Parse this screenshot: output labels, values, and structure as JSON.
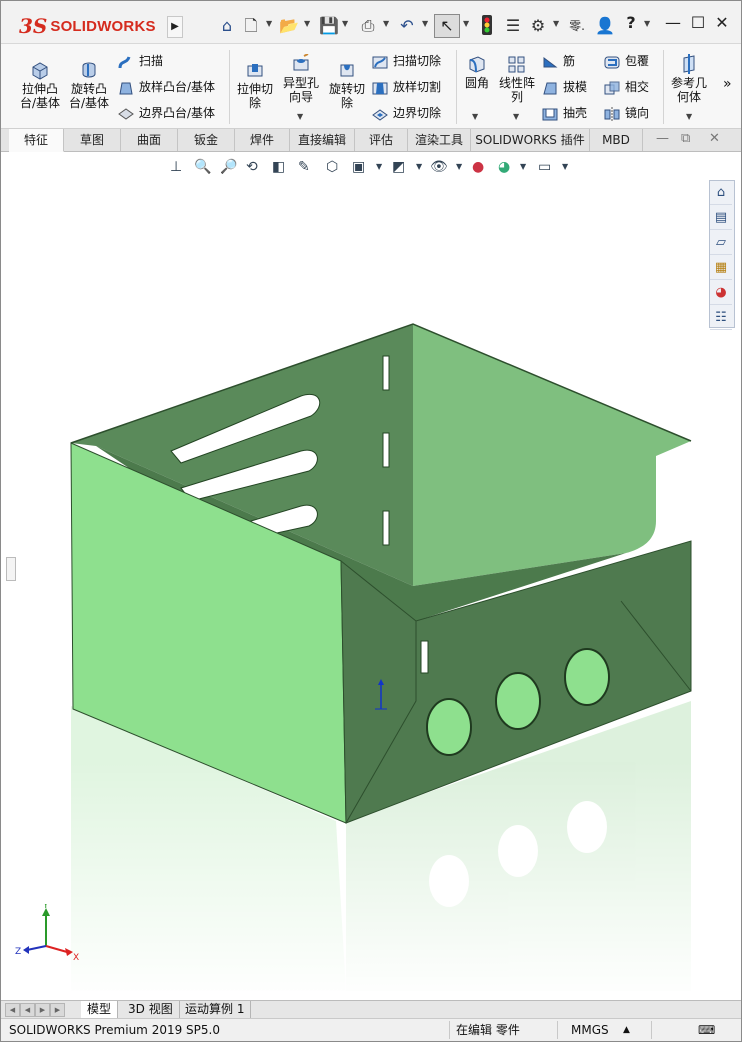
{
  "titlebar": {
    "logo_ds": "3S",
    "logo_text": "SOLIDWORKS",
    "menu_arrow": "▶",
    "help": "?",
    "minimize": "—",
    "restore": "☐",
    "close": "✕",
    "icons": [
      "home-icon",
      "new-document-icon",
      "open-icon",
      "save-icon",
      "print-icon",
      "undo-icon",
      "select-pointer-icon",
      "rebuild-icon",
      "file-properties-icon",
      "options-gear-icon",
      "search-icon",
      "user-icon",
      "help-icon"
    ]
  },
  "commands": {
    "extrude_boss": "拉伸凸\n台/基体",
    "revolve_boss": "旋转凸\n台/基体",
    "sweep": "扫描",
    "loft": "放样凸台/基体",
    "boundary": "边界凸台/基体",
    "extrude_cut": "拉伸切\n除",
    "hole_wizard": "异型孔\n向导",
    "revolve_cut": "旋转切\n除",
    "swept_cut": "扫描切除",
    "lofted_cut": "放样切割",
    "boundary_cut": "边界切除",
    "fillet": "圆角",
    "linear_pattern": "线性阵\n列",
    "rib": "筋",
    "draft": "拔模",
    "shell": "抽壳",
    "wrap": "包覆",
    "intersect": "相交",
    "mirror": "镜向",
    "ref_geometry": "参考几\n何体",
    "more": "»"
  },
  "tabs": [
    {
      "label": "特征",
      "active": true
    },
    {
      "label": "草图",
      "active": false
    },
    {
      "label": "曲面",
      "active": false
    },
    {
      "label": "钣金",
      "active": false
    },
    {
      "label": "焊件",
      "active": false
    },
    {
      "label": "直接编辑",
      "active": false
    },
    {
      "label": "评估",
      "active": false
    },
    {
      "label": "渲染工具",
      "active": false
    },
    {
      "label": "SOLIDWORKS 插件",
      "active": false
    },
    {
      "label": "MBD",
      "active": false
    }
  ],
  "doc_controls": {
    "restore": "⧉",
    "close": "✕",
    "minimize": "—"
  },
  "heads_up_icons": [
    "view-orientation-icon",
    "zoom-to-fit-icon",
    "zoom-area-icon",
    "previous-view-icon",
    "section-view-icon",
    "dynamic-annotation-icon",
    "view-orientation-cube-icon",
    "display-style-icon",
    "hide-show-icon",
    "edit-appearance-icon",
    "apply-scene-icon",
    "view-settings-icon"
  ],
  "task_pane_icons": [
    "home-icon",
    "parts-library-icon",
    "file-explorer-icon",
    "view-palette-icon",
    "appearances-icon",
    "custom-properties-icon"
  ],
  "triad": {
    "y": "Y",
    "x": "X",
    "z": "Z"
  },
  "bottom_tabs": [
    {
      "label": "模型",
      "active": true
    },
    {
      "label": "3D 视图",
      "active": false
    },
    {
      "label": "运动算例 1",
      "active": false
    }
  ],
  "status": {
    "product": "SOLIDWORKS Premium 2019 SP5.0",
    "mode": "在编辑 零件",
    "units": "MMGS",
    "units_arrow": "▲"
  },
  "colors": {
    "model_face": "#8ee08e",
    "model_dark": "#4f7a4f",
    "brand": "#d52b1e"
  }
}
